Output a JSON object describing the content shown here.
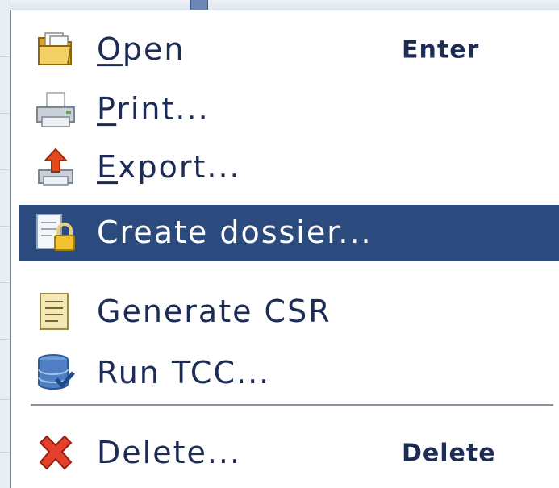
{
  "menu": {
    "items": [
      {
        "label": "Open",
        "mnemonic": "O",
        "rest": "pen",
        "shortcut": "Enter",
        "icon": "folder-icon",
        "selected": false
      },
      {
        "label": "Print...",
        "mnemonic": "P",
        "rest": "rint...",
        "shortcut": "",
        "icon": "printer-icon",
        "selected": false
      },
      {
        "label": "Export...",
        "mnemonic": "E",
        "rest": "xport...",
        "shortcut": "",
        "icon": "export-icon",
        "selected": false
      },
      {
        "label": "Create dossier...",
        "mnemonic": "",
        "rest": "Create dossier...",
        "shortcut": "",
        "icon": "lock-document-icon",
        "selected": true
      },
      {
        "label": "Generate CSR",
        "mnemonic": "",
        "rest": "Generate CSR",
        "shortcut": "",
        "icon": "certificate-icon",
        "selected": false
      },
      {
        "label": "Run TCC...",
        "mnemonic": "",
        "rest": "Run TCC...",
        "shortcut": "",
        "icon": "database-check-icon",
        "selected": false
      },
      {
        "label": "Delete...",
        "mnemonic": "",
        "rest": "Delete...",
        "shortcut": "Delete",
        "icon": "delete-x-icon",
        "selected": false
      }
    ]
  },
  "colors": {
    "selection": "#2b4a7e",
    "text": "#1c2c55",
    "selected_text": "#ffffff"
  }
}
